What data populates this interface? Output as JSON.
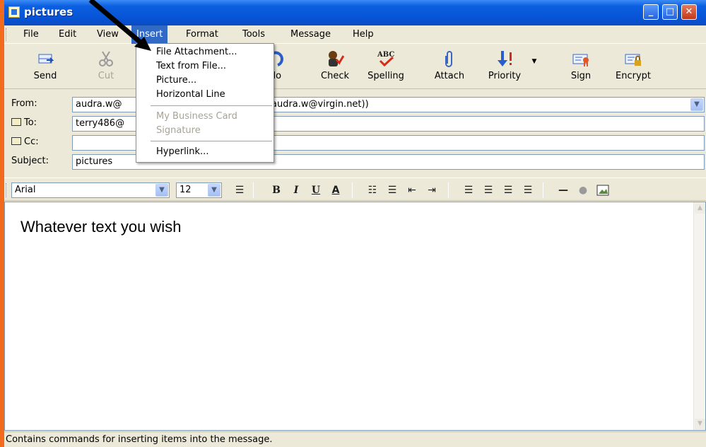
{
  "window": {
    "title": "pictures"
  },
  "colors": {
    "background": "#f26b1d",
    "titlebar": "#0854d6",
    "menu_highlight": "#316ac5"
  },
  "menubar": {
    "items": [
      "File",
      "Edit",
      "View",
      "Insert",
      "Format",
      "Tools",
      "Message",
      "Help"
    ],
    "active": "Insert"
  },
  "toolbar": {
    "send": "Send",
    "cut": "Cut",
    "undo": "do",
    "check": "Check",
    "spelling": "Spelling",
    "attach": "Attach",
    "priority": "Priority",
    "sign": "Sign",
    "encrypt": "Encrypt"
  },
  "insert_menu": {
    "file_attachment": "File Attachment...",
    "text_from_file": "Text from File...",
    "picture": "Picture...",
    "horizontal_line": "Horizontal Line",
    "business_card": "My Business Card",
    "signature": "Signature",
    "hyperlink": "Hyperlink..."
  },
  "fields": {
    "from_label": "From:",
    "from_value_left": "audra.w@",
    "from_value_right": "audra.w@virgin.net))",
    "to_label": "To:",
    "to_value": "terry486@",
    "cc_label": "Cc:",
    "cc_value": "",
    "subject_label": "Subject:",
    "subject_value": "pictures"
  },
  "format": {
    "font": "Arial",
    "size": "12"
  },
  "body": {
    "text": "Whatever text you wish"
  },
  "status": {
    "text": "Contains commands for inserting items into the message."
  }
}
